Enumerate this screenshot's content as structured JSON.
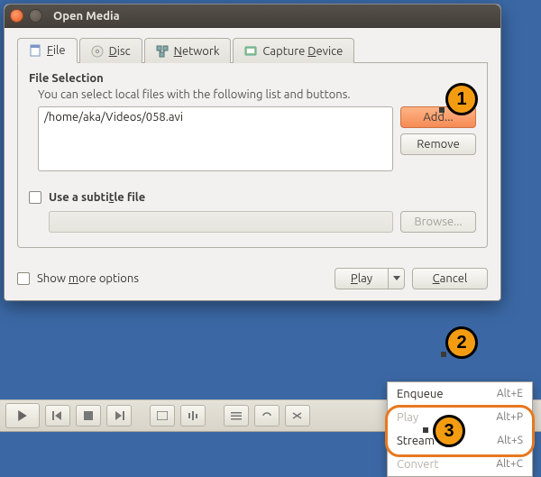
{
  "window": {
    "title": "Open Media"
  },
  "tabs": [
    {
      "label": "File",
      "accel": "F",
      "icon": "file-icon",
      "active": true
    },
    {
      "label": "Disc",
      "accel": "D",
      "icon": "disc-icon",
      "active": false
    },
    {
      "label": "Network",
      "accel": "N",
      "icon": "network-icon",
      "active": false
    },
    {
      "label": "Capture Device",
      "accel": "D",
      "icon": "capture-icon",
      "active": false
    }
  ],
  "file_section": {
    "title": "File Selection",
    "hint": "You can select local files with the following list and buttons.",
    "files": [
      "/home/aka/Videos/058.avi"
    ],
    "add_label": "Add...",
    "remove_label": "Remove"
  },
  "subtitle": {
    "checkbox_label": "Use a subtitle file",
    "input_value": "",
    "browse_label": "Browse..."
  },
  "footer": {
    "show_more_label": "Show more options",
    "play_label": "Play",
    "cancel_label": "Cancel"
  },
  "dropdown": {
    "items": [
      {
        "label": "Enqueue",
        "shortcut": "Alt+E"
      },
      {
        "label": "Play",
        "shortcut": "Alt+P"
      },
      {
        "label": "Stream",
        "shortcut": "Alt+S"
      },
      {
        "label": "Convert",
        "shortcut": "Alt+C"
      }
    ]
  },
  "toolbar": {
    "time": "--:--"
  },
  "callouts": {
    "c1": "1",
    "c2": "2",
    "c3": "3"
  },
  "colors": {
    "accent_orange": "#f58b55",
    "callout_orange": "#f39c12",
    "dialog_bg": "#f2f1f0",
    "desktop_bg": "#3b68a5"
  }
}
